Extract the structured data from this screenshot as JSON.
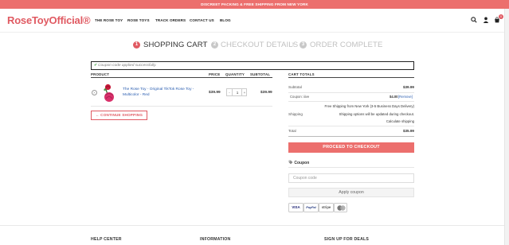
{
  "promo": {
    "text": "DISCREET PACKING & FREE SHIPPING FROM NEW YORK"
  },
  "header": {
    "logo": "RoseToyOfficial®",
    "nav": [
      {
        "label": "THE ROSE TOY"
      },
      {
        "label": "ROSE TOYS"
      },
      {
        "label": "TRACK ORDERS"
      },
      {
        "label": "CONTACT US"
      },
      {
        "label": "BLOG"
      }
    ],
    "icons": [
      "search-icon",
      "user-icon",
      "cart-icon"
    ],
    "cart_count": "0"
  },
  "steps": [
    {
      "num": "1",
      "label": "SHOPPING CART",
      "active": true
    },
    {
      "num": "2",
      "label": "CHECKOUT DETAILS",
      "active": false
    },
    {
      "num": "3",
      "label": "ORDER COMPLETE",
      "active": false
    }
  ],
  "notice": {
    "text": "Coupon code applied successfully."
  },
  "cart_table": {
    "headers": {
      "product": "PRODUCT",
      "price": "PRICE",
      "quantity": "QUANTITY",
      "subtotal": "SUBTOTAL"
    },
    "items": [
      {
        "remove": "×",
        "name": "The Rose Toy - Original TikTok Rose Toy - Multicolor - Red",
        "price": "$39.99",
        "qty": "1",
        "subtotal": "$39.99"
      }
    ],
    "qty_minus": "-",
    "qty_plus": "+",
    "continue_label": "← CONTINUE SHOPPING"
  },
  "totals": {
    "heading": "CART TOTALS",
    "subtotal_label": "Subtotal",
    "subtotal_value": "$39.99",
    "coupon_label": "Coupon: iiive",
    "coupon_value": "$4.00",
    "coupon_remove": "[Remove]",
    "shipping_label": "Shipping",
    "shipping_lines": [
      "Free Shipping from New York (3-5 Business Days Delivery)",
      "Shipping options will be updated during checkout.",
      "Calculate shipping"
    ],
    "total_label": "Total",
    "total_value": "$35.99",
    "checkout_label": "PROCEED TO CHECKOUT",
    "coupon_heading": "Coupon",
    "coupon_placeholder": "Coupon code",
    "apply_label": "Apply coupon",
    "payments": [
      "VISA",
      "PayPal",
      "stripe",
      ""
    ]
  },
  "footer": {
    "headings": [
      "HELP CENTER",
      "INFORMATION",
      "SIGN UP FOR DEALS"
    ]
  },
  "colors": {
    "brand": "#e05a62",
    "promo_bg": "#ec6f6d",
    "link": "#2a5db0"
  }
}
